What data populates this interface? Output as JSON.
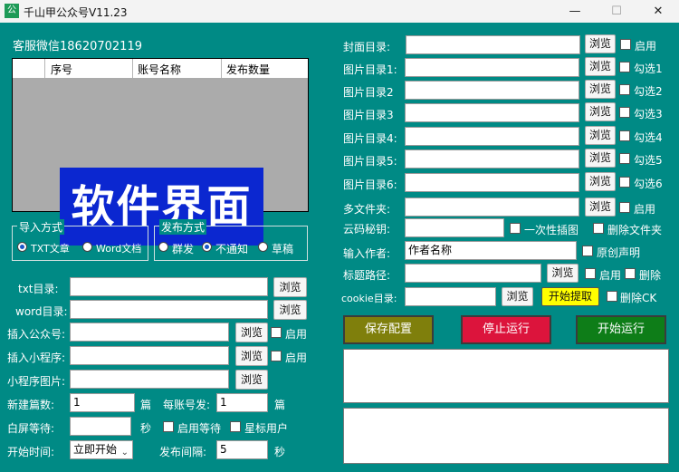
{
  "window": {
    "title": "千山甲公众号V11.23",
    "icon": "公",
    "min": "—",
    "max": "☐",
    "close": "✕"
  },
  "service": "客服微信18620702119",
  "table": {
    "columns": [
      "序号",
      "账号名称",
      "发布数量"
    ],
    "watermark": "软件界面"
  },
  "import": {
    "legend": "导入方式",
    "options": [
      "TXT文章",
      "Word文档"
    ]
  },
  "publish": {
    "legend": "发布方式",
    "options": [
      "群发",
      "不通知",
      "草稿"
    ]
  },
  "left_form": {
    "txt_dir": "txt目录:",
    "word_dir": "word目录:",
    "insert_account": "插入公众号:",
    "insert_miniapp": "插入小程序:",
    "miniapp_img": "小程序图片:",
    "browse": "浏览",
    "enable": "启用",
    "new_count_label": "新建篇数:",
    "new_count": "1",
    "unit_pian": "篇",
    "per_account_label": "每账号发:",
    "per_account": "1",
    "wait_label": "白屏等待:",
    "unit_sec": "秒",
    "enable_wait": "启用等待",
    "star_user": "星标用户",
    "start_time_label": "开始时间:",
    "start_time": "立即开始",
    "interval_label": "发布间隔:",
    "interval": "5"
  },
  "right_form": {
    "cover_dir": "封面目录:",
    "img_dirs": [
      "图片目录1:",
      "图片目录2",
      "图片目录3",
      "图片目录4:",
      "图片目录5:",
      "图片目录6:"
    ],
    "checks": [
      "勾选1",
      "勾选2",
      "勾选3",
      "勾选4",
      "勾选5",
      "勾选6"
    ],
    "multi_folder": "多文件夹:",
    "browse": "浏览",
    "enable": "启用",
    "yun_key_label": "云码秘钥:",
    "one_time_img": "一次性插图",
    "delete_folder": "删除文件夹",
    "author_label": "输入作者:",
    "author_value": "作者名称",
    "original": "原创声明",
    "title_path": "标题路径:",
    "delete": "删除",
    "cookie_dir": "cookie目录:",
    "start_extract": "开始提取",
    "delete_ck": "删除CK"
  },
  "actions": {
    "save": "保存配置",
    "stop": "停止运行",
    "start": "开始运行"
  },
  "colors": {
    "bg": "#008a85",
    "save": "#7f7f0c",
    "stop": "#dc143c",
    "start": "#0e7d18",
    "watermark": "#0b27d0",
    "extract": "#ffff00"
  }
}
